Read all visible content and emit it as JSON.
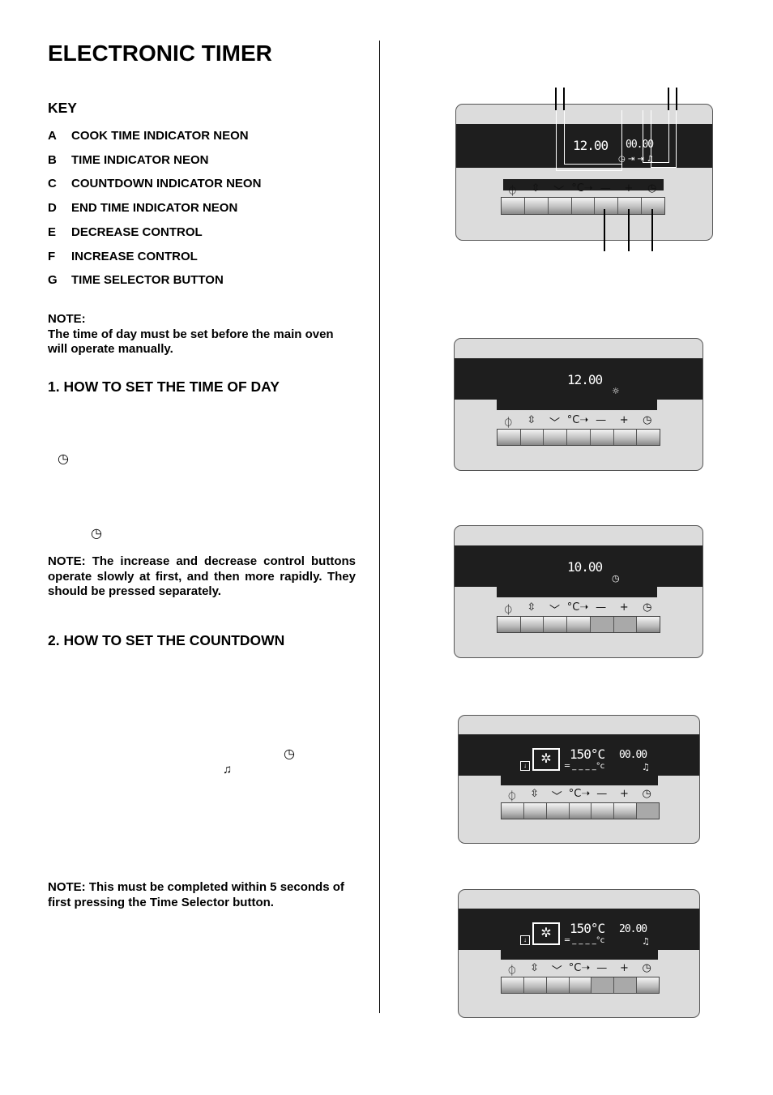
{
  "title": "ELECTRONIC TIMER",
  "key": {
    "heading": "KEY",
    "items": [
      {
        "letter": "A",
        "label": "COOK TIME INDICATOR NEON"
      },
      {
        "letter": "B",
        "label": "TIME INDICATOR NEON"
      },
      {
        "letter": "C",
        "label": "COUNTDOWN INDICATOR NEON"
      },
      {
        "letter": "D",
        "label": "END TIME INDICATOR NEON"
      },
      {
        "letter": "E",
        "label": "DECREASE CONTROL"
      },
      {
        "letter": "F",
        "label": "INCREASE CONTROL"
      },
      {
        "letter": "G",
        "label": "TIME SELECTOR BUTTON"
      }
    ]
  },
  "note1": {
    "label": "NOTE:",
    "text": "The time of day must be set before the main oven will operate manually."
  },
  "section1": {
    "heading": "1.  HOW TO SET THE TIME OF DAY"
  },
  "note2": {
    "text": "NOTE:   The increase and decrease control buttons operate slowly at first, and then more rapidly.  They should be pressed separately."
  },
  "section2": {
    "heading": "2.  HOW TO SET THE COUNTDOWN"
  },
  "note3": {
    "text": "NOTE:  This must be completed within 5 seconds of first pressing the Time Selector button."
  },
  "button_icons": [
    "power-icon",
    "function-selector-icon",
    "chevron-down-icon",
    "fast-heat-icon",
    "minus-icon",
    "plus-icon",
    "timer-icon"
  ],
  "button_glyphs": [
    "⏀",
    "⇳",
    "﹀",
    "°C➝",
    "—",
    "+",
    "◷"
  ],
  "panels": [
    {
      "time": "12.00",
      "right": "00.00",
      "indicators": "◷ ⇥ ⇥ ♫",
      "pressed": []
    },
    {
      "time": "12.00",
      "indicator": "☼",
      "pressed": []
    },
    {
      "time": "10.00",
      "indicator": "◷",
      "pressed": [
        4,
        5
      ]
    },
    {
      "temp": "150°C",
      "right": "00.00",
      "temp_bar": "═ _ _ _ _°c",
      "indicator": "♫",
      "pressed": [
        6
      ]
    },
    {
      "temp": "150°C",
      "right": "20.00",
      "temp_bar": "═ _ _ _ _°c",
      "indicator": "♫",
      "pressed": [
        4,
        5
      ]
    }
  ]
}
